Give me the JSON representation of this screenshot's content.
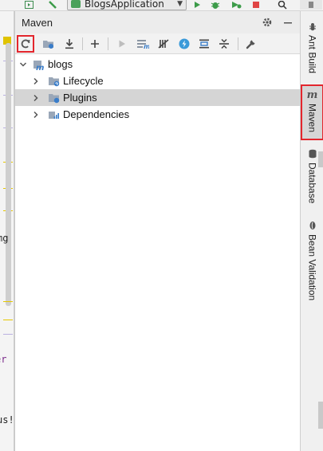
{
  "ide_toolbar": {
    "run_config_label": "BlogsApplication"
  },
  "gutter": {
    "text_lines": [
      "mg",
      "er",
      "us!"
    ]
  },
  "panel": {
    "title": "Maven",
    "header_buttons": [
      "gear-icon",
      "minimize-icon"
    ],
    "toolbar": [
      {
        "name": "reload-all-projects-button",
        "icon": "reload-icon",
        "highlighted": true
      },
      {
        "name": "generate-sources-button",
        "icon": "folder-refresh-icon",
        "highlighted": false
      },
      {
        "name": "download-sources-button",
        "icon": "download-icon",
        "highlighted": false
      },
      {
        "name": "add-maven-project-button",
        "icon": "plus-icon",
        "highlighted": false
      },
      {
        "name": "run-maven-build-button",
        "icon": "play-icon",
        "highlighted": false
      },
      {
        "name": "execute-maven-goal-button",
        "icon": "maven-goal-icon",
        "highlighted": false
      },
      {
        "name": "toggle-offline-mode-button",
        "icon": "offline-icon",
        "highlighted": false
      },
      {
        "name": "skip-tests-button",
        "icon": "lightning-icon",
        "highlighted": false
      },
      {
        "name": "show-dependencies-button",
        "icon": "diagram-icon",
        "highlighted": false
      },
      {
        "name": "collapse-all-button",
        "icon": "collapse-icon",
        "highlighted": false
      },
      {
        "name": "maven-settings-button",
        "icon": "wrench-icon",
        "highlighted": false
      }
    ],
    "tree": {
      "root": {
        "label": "blogs",
        "expanded": true
      },
      "children": [
        {
          "label": "Lifecycle",
          "expanded": false,
          "selected": false,
          "icon": "lifecycle-folder-icon"
        },
        {
          "label": "Plugins",
          "expanded": false,
          "selected": true,
          "icon": "plugins-folder-icon"
        },
        {
          "label": "Dependencies",
          "expanded": false,
          "selected": false,
          "icon": "dependencies-icon"
        }
      ]
    }
  },
  "right_strip": {
    "tabs": [
      {
        "label": "Ant Build",
        "icon": "ant-icon",
        "active": false
      },
      {
        "label": "Maven",
        "icon": "maven-m-icon",
        "active": true
      },
      {
        "label": "Database",
        "icon": "database-icon",
        "active": false
      },
      {
        "label": "Bean Validation",
        "icon": "bean-validation-icon",
        "active": false
      }
    ]
  },
  "colors": {
    "highlight_box": "#e3262d",
    "selected_row": "#d5d5d5",
    "maven_blue": "#3a7dc9",
    "panel_header": "#ececec"
  }
}
